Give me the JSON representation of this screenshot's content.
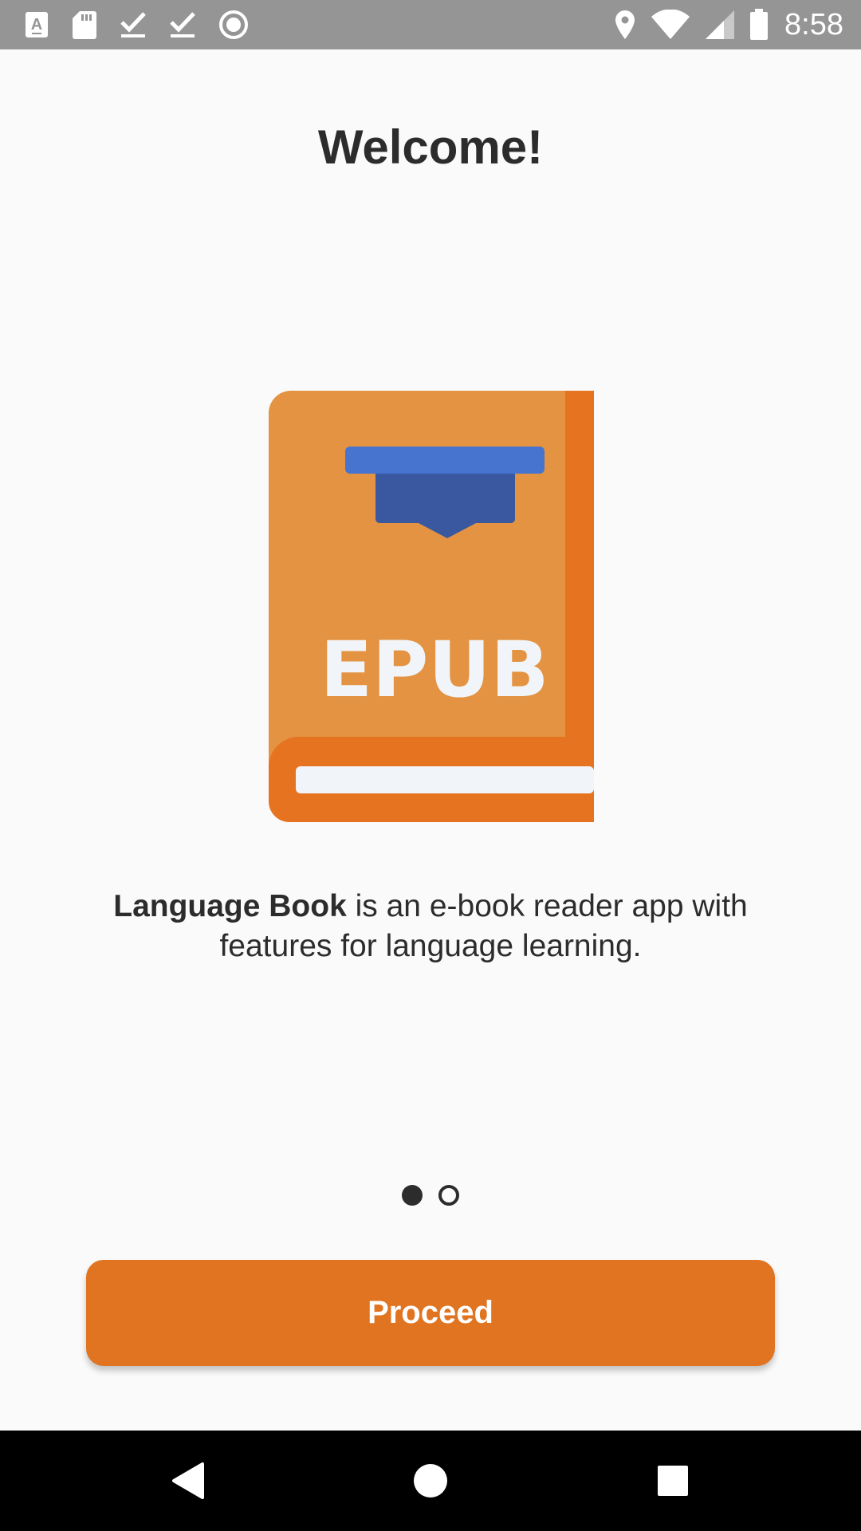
{
  "status_bar": {
    "time": "8:58",
    "left_icons": [
      "font-download-icon",
      "sd-card-icon",
      "check-icon",
      "check-icon",
      "record-icon"
    ],
    "right_icons": [
      "location-icon",
      "wifi-icon",
      "cellular-signal-icon",
      "battery-icon"
    ]
  },
  "page": {
    "title": "Welcome!",
    "illustration": {
      "icon": "epub-book-icon",
      "label": "EPUB"
    },
    "description": {
      "app_name": "Language Book",
      "text": " is an e-book reader app with features for language learning."
    },
    "pager": {
      "current": 1,
      "total": 2
    },
    "proceed_label": "Proceed"
  },
  "navigation_bar": {
    "buttons": [
      "back-icon",
      "home-icon",
      "recents-icon"
    ]
  },
  "colors": {
    "accent": "#e07420",
    "book_cover": "#e39341",
    "book_spine": "#e6731f",
    "cap_top": "#4674ce",
    "cap_base": "#3a589f",
    "background": "#fafafa",
    "text": "#2c2c2c",
    "status_bar": "#959595"
  }
}
